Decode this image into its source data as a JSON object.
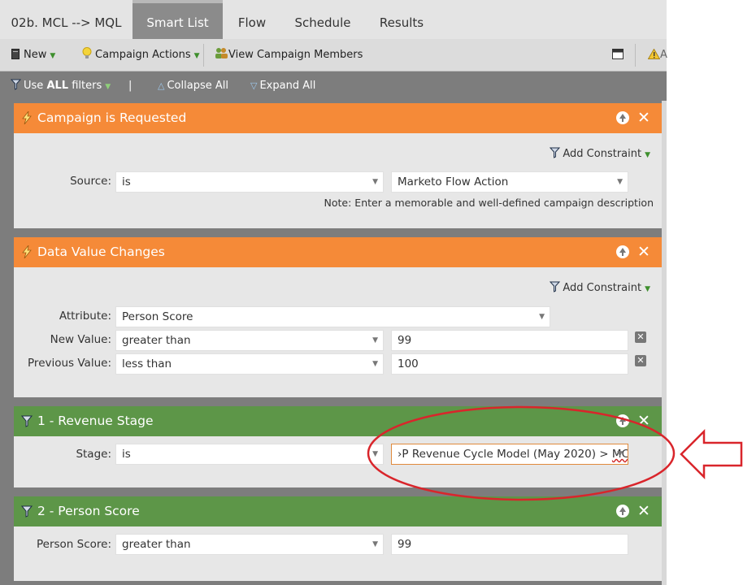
{
  "tabs": [
    {
      "label": "02b. MCL --> MQL"
    },
    {
      "label": "Smart List"
    },
    {
      "label": "Flow"
    },
    {
      "label": "Schedule"
    },
    {
      "label": "Results"
    }
  ],
  "toolbar": {
    "new_label": "New",
    "campaign_actions_label": "Campaign Actions",
    "view_members_label": "View Campaign Members",
    "right_partial": "A"
  },
  "filterbar": {
    "use_prefix": "Use",
    "use_all": "ALL",
    "use_suffix": "filters",
    "separator": "|",
    "collapse_all": "Collapse All",
    "expand_all": "Expand All"
  },
  "panels": [
    {
      "title": "Campaign is Requested",
      "add_constraint": "Add Constraint",
      "source_label": "Source:",
      "source_operator": "is",
      "source_value": "Marketo Flow Action",
      "note": "Note: Enter a memorable and well-defined campaign description"
    },
    {
      "title": "Data Value Changes",
      "add_constraint": "Add Constraint",
      "attribute_label": "Attribute:",
      "attribute_value": "Person Score",
      "new_value_label": "New Value:",
      "new_value_operator": "greater than",
      "new_value": "99",
      "prev_value_label": "Previous Value:",
      "prev_value_operator": "less than",
      "prev_value": "100"
    },
    {
      "title": "1 - Revenue Stage",
      "stage_label": "Stage:",
      "stage_operator": "is",
      "stage_value_prefix": "›P Revenue Cycle Model (May 2020) > ",
      "stage_value_suffix": "MCL"
    },
    {
      "title": "2 - Person Score",
      "score_label": "Person Score:",
      "score_operator": "greater than",
      "score_value": "99"
    }
  ],
  "colors": {
    "orange_header": "#f58a38",
    "green_header": "#5d9648",
    "annotation_red": "#d9252b"
  }
}
